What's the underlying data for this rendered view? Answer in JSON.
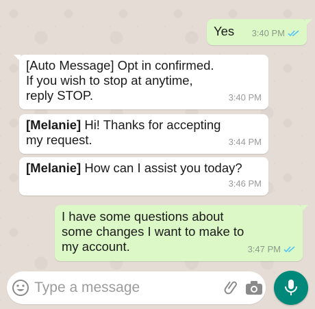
{
  "colors": {
    "outgoing_bubble": "#dcf8c6",
    "incoming_bubble": "#ffffff",
    "accent": "#00897b",
    "wallpaper": "#e5ddd5",
    "read_ticks": "#4fc3f7"
  },
  "messages": [
    {
      "direction": "out",
      "text": "Yes",
      "time": "3:40 PM",
      "status": "read"
    },
    {
      "direction": "in",
      "text": "[Auto Message] Opt in confirmed. If you wish to stop at anytime, reply STOP.",
      "line1": "[Auto Message] Opt in confirmed.",
      "line2": "If you wish to stop at anytime,",
      "line3": "reply STOP.",
      "time": "3:40 PM"
    },
    {
      "direction": "in",
      "sender": "[Melanie]",
      "text": " Hi! Thanks for accepting",
      "line2": "my request.",
      "time": "3:44 PM"
    },
    {
      "direction": "in",
      "sender": "[Melanie]",
      "text": " How can I assist you today?",
      "time": "3:46 PM"
    },
    {
      "direction": "out",
      "line1": "I have some questions about",
      "line2": "some changes I want to make to",
      "line3": "my account.",
      "time": "3:47 PM",
      "status": "read"
    }
  ],
  "composer": {
    "placeholder": "Type a message",
    "emoji_icon": "emoji-icon",
    "attach_icon": "paperclip-icon",
    "camera_icon": "camera-icon",
    "mic_icon": "microphone-icon"
  }
}
